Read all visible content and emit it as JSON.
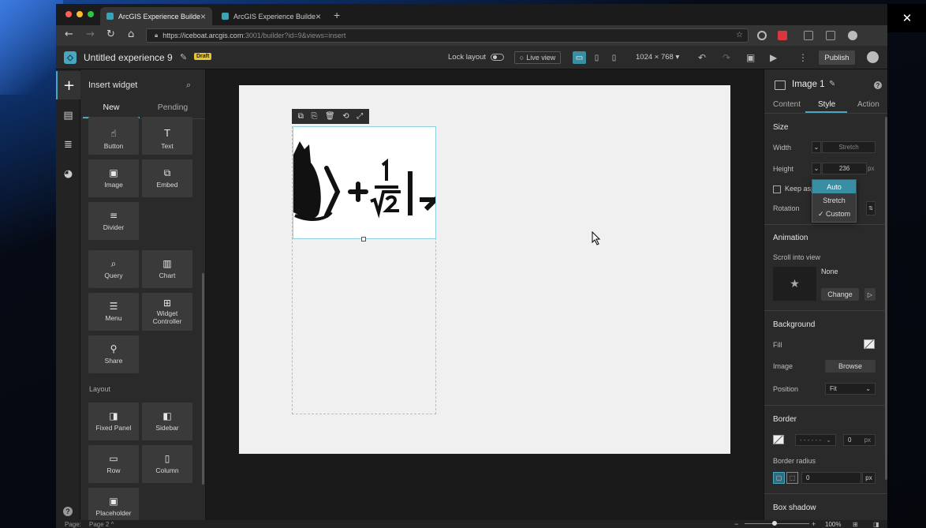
{
  "window_controls": {
    "minimize": "—",
    "maximize": "☐",
    "close": "✕"
  },
  "browser": {
    "tabs": [
      {
        "title": "ArcGIS Experience Builder",
        "close": "×"
      },
      {
        "title": "ArcGIS Experience Builder",
        "close": "×"
      }
    ],
    "new_tab": "+",
    "url_main": "https://iceboat.arcgis.com",
    "url_rest": ":3001/builder?id=9&views=insert"
  },
  "app": {
    "title": "Untitled experience 9",
    "draft_badge": "Draft",
    "lock_layout": "Lock layout",
    "live_view": "Live view",
    "resolution": "1024 × 768 ▾",
    "publish": "Publish",
    "accent": "#4aa6c0"
  },
  "insert_panel": {
    "title": "Insert widget",
    "tabs": [
      "New",
      "Pending"
    ],
    "widgets": [
      {
        "label": "Button",
        "icon": "☝"
      },
      {
        "label": "Text",
        "icon": "T"
      },
      {
        "label": "Image",
        "icon": "▣"
      },
      {
        "label": "Embed",
        "icon": "⧉"
      },
      {
        "label": "Divider",
        "icon": "≡"
      },
      {
        "label": "Query",
        "icon": "⌕"
      },
      {
        "label": "Chart",
        "icon": "▥"
      },
      {
        "label": "Menu",
        "icon": "☰"
      },
      {
        "label": "Widget Controller",
        "icon": "⊞"
      },
      {
        "label": "Share",
        "icon": "⚲"
      }
    ],
    "layout_label": "Layout",
    "layout_widgets": [
      {
        "label": "Fixed Panel",
        "icon": "◨"
      },
      {
        "label": "Sidebar",
        "icon": "◧"
      },
      {
        "label": "Row",
        "icon": "▭"
      },
      {
        "label": "Column",
        "icon": "▯"
      },
      {
        "label": "Placeholder",
        "icon": "▣"
      }
    ],
    "page_label": "Page:",
    "page_value": "Page 2 ^"
  },
  "props": {
    "title": "Image 1",
    "tabs": [
      "Content",
      "Style",
      "Action"
    ],
    "size_title": "Size",
    "width_label": "Width",
    "width_value": "Stretch",
    "height_label": "Height",
    "height_value": "236",
    "height_unit": "px",
    "keep_aspect": "Keep asp",
    "rotation_label": "Rotation",
    "dropdown_options": [
      "Auto",
      "Stretch",
      "✓ Custom"
    ],
    "animation_title": "Animation",
    "scroll_into_view": "Scroll into view",
    "animation_value": "None",
    "change_button": "Change",
    "background_title": "Background",
    "fill_label": "Fill",
    "image_label": "Image",
    "browse_button": "Browse",
    "position_label": "Position",
    "position_value": "Fit",
    "border_title": "Border",
    "border_width": "0",
    "border_unit": "px",
    "border_radius_label": "Border radius",
    "border_radius_value": "0",
    "border_radius_unit": "px",
    "box_shadow_title": "Box shadow"
  },
  "status": {
    "zoom": "100%"
  }
}
